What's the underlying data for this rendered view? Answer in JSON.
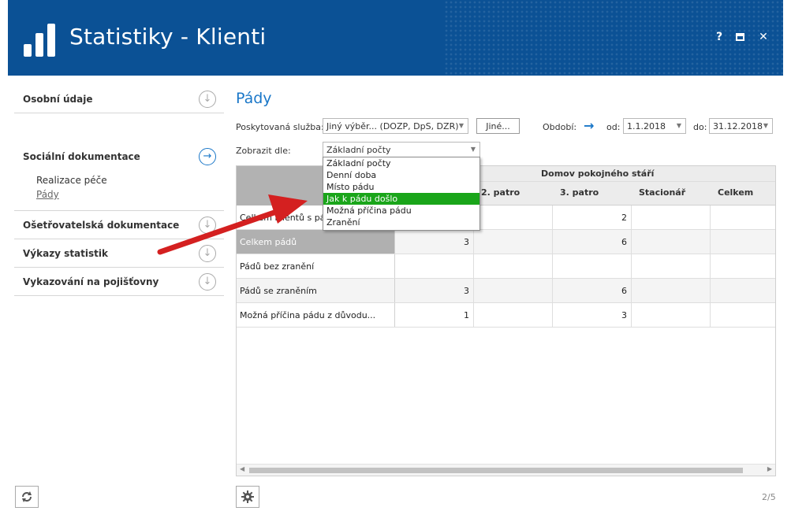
{
  "window": {
    "title": "Statistiky - Klienti",
    "help_label": "?",
    "close_label": "✕"
  },
  "sidebar": {
    "items": [
      {
        "label": "Osobní údaje",
        "icon": "arrow-down-circle-icon"
      },
      {
        "label": "Sociální dokumentace",
        "icon": "arrow-right-circle-icon",
        "subitems": [
          {
            "label": "Realizace péče"
          },
          {
            "label": "Pády"
          }
        ]
      },
      {
        "label": "Ošetřovatelská dokumentace",
        "icon": "arrow-down-circle-icon"
      },
      {
        "label": "Výkazy statistik",
        "icon": "arrow-down-circle-icon"
      },
      {
        "label": "Vykazování na pojišťovny",
        "icon": "arrow-down-circle-icon"
      }
    ]
  },
  "main": {
    "title": "Pády",
    "service": {
      "label": "Poskytovaná služba:",
      "value": "Jiný výběr... (DOZP, DpS, DZR)",
      "other_button": "Jiné..."
    },
    "period": {
      "label": "Období:",
      "from_label": "od:",
      "from_value": "1.1.2018",
      "to_label": "do:",
      "to_value": "31.12.2018"
    },
    "display_by": {
      "label": "Zobrazit dle:",
      "value": "Základní počty",
      "options": [
        "Základní počty",
        "Denní doba",
        "Místo pádu",
        "Jak k pádu došlo",
        "Možná příčina pádu",
        "Zranění"
      ],
      "highlighted_index": 3
    }
  },
  "table": {
    "group_header": "Domov pokojného stáří",
    "columns": [
      "2. patro",
      "3. patro",
      "Stacionář",
      "Celkem"
    ],
    "rows": [
      {
        "label": "Celkem klientů s pádem",
        "values": [
          "",
          "",
          "2",
          "",
          ""
        ]
      },
      {
        "label": "Celkem pádů",
        "values": [
          "3",
          "",
          "6",
          "",
          ""
        ]
      },
      {
        "label": "Pádů bez zranění",
        "values": [
          "",
          "",
          "",
          "",
          ""
        ]
      },
      {
        "label": "Pádů se zraněním",
        "values": [
          "3",
          "",
          "6",
          "",
          ""
        ]
      },
      {
        "label": "Možná příčina pádu z důvodu...",
        "values": [
          "1",
          "",
          "3",
          "",
          ""
        ]
      }
    ]
  },
  "footer": {
    "page_indicator": "2/5"
  },
  "colors": {
    "header_bg": "#0b5195",
    "accent": "#1a77c8",
    "highlight": "#1aa51a",
    "annotation_arrow": "#d42020"
  }
}
